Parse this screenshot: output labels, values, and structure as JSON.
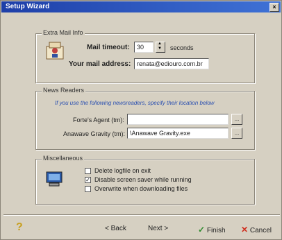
{
  "window": {
    "title": "Setup Wizard",
    "close_label": "×"
  },
  "extra_mail": {
    "title": "Extra Mail Info",
    "timeout_label": "Mail timeout:",
    "timeout_value": "30",
    "timeout_unit": "seconds",
    "address_label": "Your mail address:",
    "address_value": "renata@ediouro.com.br"
  },
  "news_readers": {
    "title": "News Readers",
    "instruction": "If you use the following newsreaders, specify their location below",
    "forte_label": "Forte's Agent (tm):",
    "forte_value": "",
    "anawave_label": "Anawave Gravity (tm):",
    "anawave_value": "\\Anawave Gravity.exe",
    "browse_label": "..."
  },
  "misc": {
    "title": "Miscellaneous",
    "options": [
      {
        "label": "Delete logfile on exit",
        "checked": false
      },
      {
        "label": "Disable screen saver while running",
        "checked": true
      },
      {
        "label": "Overwrite when downloading files",
        "checked": false
      }
    ]
  },
  "footer": {
    "help": "?",
    "back": "< Back",
    "next": "Next >",
    "finish": "Finish",
    "cancel": "Cancel"
  },
  "colors": {
    "title_bar": "#1e3fa8",
    "instruction_text": "#2a4fb0",
    "finish_check": "#2e8b2e",
    "cancel_x": "#d03020"
  }
}
